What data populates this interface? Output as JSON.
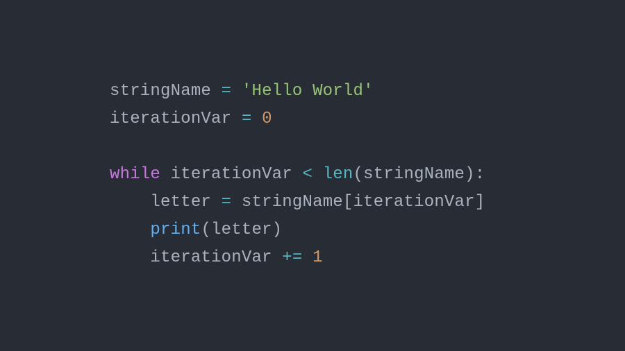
{
  "code": {
    "lines": [
      [
        {
          "cls": "tok-var",
          "t": "stringName"
        },
        {
          "cls": "tok-punct",
          "t": " "
        },
        {
          "cls": "tok-op",
          "t": "="
        },
        {
          "cls": "tok-punct",
          "t": " "
        },
        {
          "cls": "tok-str",
          "t": "'Hello World'"
        }
      ],
      [
        {
          "cls": "tok-var",
          "t": "iterationVar"
        },
        {
          "cls": "tok-punct",
          "t": " "
        },
        {
          "cls": "tok-op",
          "t": "="
        },
        {
          "cls": "tok-punct",
          "t": " "
        },
        {
          "cls": "tok-num",
          "t": "0"
        }
      ],
      [],
      [
        {
          "cls": "tok-kw",
          "t": "while"
        },
        {
          "cls": "tok-punct",
          "t": " "
        },
        {
          "cls": "tok-var",
          "t": "iterationVar"
        },
        {
          "cls": "tok-punct",
          "t": " "
        },
        {
          "cls": "tok-op",
          "t": "<"
        },
        {
          "cls": "tok-punct",
          "t": " "
        },
        {
          "cls": "tok-builtin",
          "t": "len"
        },
        {
          "cls": "tok-punct",
          "t": "("
        },
        {
          "cls": "tok-var",
          "t": "stringName"
        },
        {
          "cls": "tok-punct",
          "t": ")"
        },
        {
          "cls": "tok-punct",
          "t": ":"
        }
      ],
      [
        {
          "cls": "tok-punct",
          "t": "    "
        },
        {
          "cls": "tok-var",
          "t": "letter"
        },
        {
          "cls": "tok-punct",
          "t": " "
        },
        {
          "cls": "tok-op",
          "t": "="
        },
        {
          "cls": "tok-punct",
          "t": " "
        },
        {
          "cls": "tok-var",
          "t": "stringName"
        },
        {
          "cls": "tok-punct",
          "t": "["
        },
        {
          "cls": "tok-var",
          "t": "iterationVar"
        },
        {
          "cls": "tok-punct",
          "t": "]"
        }
      ],
      [
        {
          "cls": "tok-punct",
          "t": "    "
        },
        {
          "cls": "tok-func",
          "t": "print"
        },
        {
          "cls": "tok-punct",
          "t": "("
        },
        {
          "cls": "tok-var",
          "t": "letter"
        },
        {
          "cls": "tok-punct",
          "t": ")"
        }
      ],
      [
        {
          "cls": "tok-punct",
          "t": "    "
        },
        {
          "cls": "tok-var",
          "t": "iterationVar"
        },
        {
          "cls": "tok-punct",
          "t": " "
        },
        {
          "cls": "tok-op",
          "t": "+="
        },
        {
          "cls": "tok-punct",
          "t": " "
        },
        {
          "cls": "tok-num",
          "t": "1"
        }
      ]
    ]
  },
  "colors": {
    "background": "#282c34",
    "default": "#abb2bf",
    "operator": "#56b6c2",
    "string": "#98c379",
    "number": "#d19a66",
    "keyword": "#c678dd",
    "builtin": "#56b6c2",
    "function": "#61afef"
  }
}
